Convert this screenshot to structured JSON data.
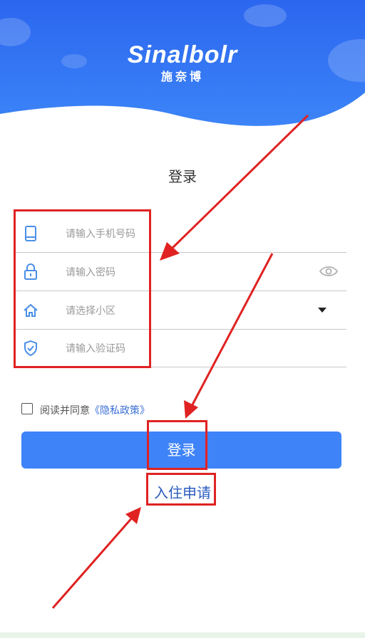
{
  "brand": {
    "logo_en": "Sinalbolr",
    "logo_cn": "施奈博"
  },
  "page": {
    "title": "登录"
  },
  "form": {
    "phone_placeholder": "请输入手机号码",
    "password_placeholder": "请输入密码",
    "community_placeholder": "请选择小区",
    "code_placeholder": "请输入验证码"
  },
  "agreement": {
    "text": "阅读并同意",
    "policy_link": "《隐私政策》",
    "checked": false
  },
  "actions": {
    "login_label": "登录",
    "apply_label": "入住申请"
  },
  "icons": [
    "phone-icon",
    "lock-icon",
    "home-icon",
    "shield-check-icon",
    "eye-icon",
    "dropdown-caret-icon"
  ],
  "colors": {
    "primary": "#3f83f8",
    "header_blue": "#2f6bf0",
    "annotation_red": "#e02222",
    "link": "#3b6fd6"
  }
}
